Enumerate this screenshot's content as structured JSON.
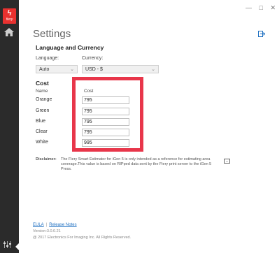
{
  "window": {
    "controls": {
      "minimize": "—",
      "maximize": "□",
      "close": "✕"
    }
  },
  "sidebar": {
    "logo_word": "fiery",
    "icons": [
      "home-icon",
      "settings-sliders-icon"
    ]
  },
  "page": {
    "title": "Settings"
  },
  "language_currency": {
    "heading": "Language and Currency",
    "language_label": "Language:",
    "language_value": "Auto",
    "currency_label": "Currency:",
    "currency_value": "USD - $"
  },
  "cost": {
    "heading": "Cost",
    "col_name": "Name",
    "col_cost": "Cost",
    "rows": [
      {
        "name": "Orange",
        "cost": "795"
      },
      {
        "name": "Green",
        "cost": "795"
      },
      {
        "name": "Blue",
        "cost": "795"
      },
      {
        "name": "Clear",
        "cost": "795"
      },
      {
        "name": "White",
        "cost": "995"
      }
    ]
  },
  "disclaimer": {
    "label": "Disclaimer:",
    "text": "The Fiery Smart Estimator for iGen 5 is only intended as a reference for estimating area coverage.This value is based on RIPped data sent by the Fiery print server to the iGen 5 Press."
  },
  "footer": {
    "eula": "EULA",
    "release_notes": "Release Notes",
    "version": "Version:3.0.0.21",
    "copyright": "@ 2017 Electronics For Imaging Inc. All Rights Reserved."
  },
  "colors": {
    "sidebar": "#2b2b2b",
    "brand": "#e8312f",
    "highlight": "#e8364a",
    "link": "#1d6fc1"
  }
}
